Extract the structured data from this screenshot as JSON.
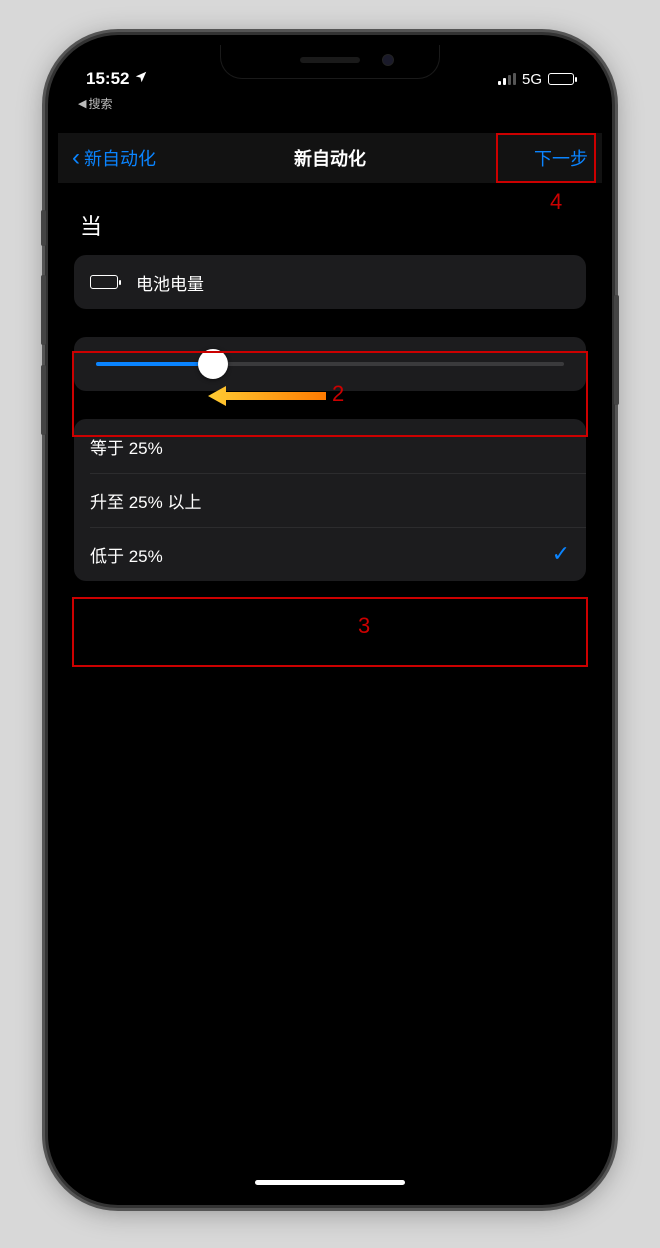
{
  "status": {
    "time": "15:52",
    "back_app_label": "搜索",
    "network": "5G"
  },
  "nav": {
    "back_label": "新自动化",
    "title": "新自动化",
    "next_label": "下一步"
  },
  "section_label": "当",
  "trigger": {
    "label": "电池电量"
  },
  "slider": {
    "percent": 25
  },
  "options": [
    {
      "label": "等于 25%",
      "selected": false
    },
    {
      "label": "升至 25% 以上",
      "selected": false
    },
    {
      "label": "低于 25%",
      "selected": true
    }
  ],
  "annotations": {
    "n2": "2",
    "n3": "3",
    "n4": "4"
  }
}
